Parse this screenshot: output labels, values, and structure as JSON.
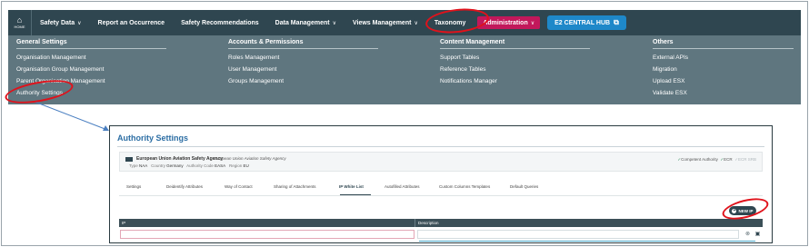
{
  "nav": {
    "home_label": "HOME",
    "items": [
      {
        "label": "Safety Data",
        "chevron": true
      },
      {
        "label": "Report an Occurrence",
        "chevron": false
      },
      {
        "label": "Safety Recommendations",
        "chevron": false
      },
      {
        "label": "Data Management",
        "chevron": true
      },
      {
        "label": "Views Management",
        "chevron": true
      },
      {
        "label": "Taxonomy",
        "chevron": false
      },
      {
        "label": "Administration",
        "chevron": true
      }
    ],
    "hub_label": "E2 CENTRAL HUB",
    "colors": {
      "bar": "#2f4650",
      "active": "#c2185b",
      "hub": "#1e88c9"
    }
  },
  "menu": {
    "columns": [
      {
        "heading": "General Settings",
        "items": [
          "Organisation Management",
          "Organisation Group Management",
          "Parent Organisation Management",
          "Authority Settings"
        ]
      },
      {
        "heading": "Accounts & Permissions",
        "items": [
          "Roles Management",
          "User Management",
          "Groups Management"
        ]
      },
      {
        "heading": "Content Management",
        "items": [
          "Support Tables",
          "Reference Tables",
          "Notifications Manager"
        ]
      },
      {
        "heading": "Others",
        "items": [
          "External APIs",
          "Migration",
          "Upload ESX",
          "Validate ESX"
        ]
      }
    ]
  },
  "panel": {
    "title": "Authority Settings",
    "org": {
      "name": "European Union Aviation Safety Agency",
      "subtitle": "European Union Aviation Safety Agency",
      "type_label": "Type",
      "type_value": "NAA",
      "country_label": "Country",
      "country_value": "Germany",
      "code_label": "Authority Code",
      "code_value": "EASA",
      "region_label": "Region",
      "region_value": "EU",
      "status": [
        {
          "label": "Competent Authority",
          "checked": true
        },
        {
          "label": "ECR",
          "checked": true
        },
        {
          "label": "ECR SRB",
          "checked": false
        }
      ]
    },
    "tabs": [
      "Settings",
      "Deidentify Attributes",
      "Way of Contact",
      "Sharing of Attachments",
      "IP White List",
      "Autofilled Attributes",
      "Custom Columns Templates",
      "Default Queries"
    ],
    "active_tab": "IP White List",
    "new_button": "NEW IP",
    "table": {
      "columns": [
        "IP",
        "Description"
      ]
    },
    "row_actions": [
      "cancel-icon",
      "save-icon"
    ]
  }
}
